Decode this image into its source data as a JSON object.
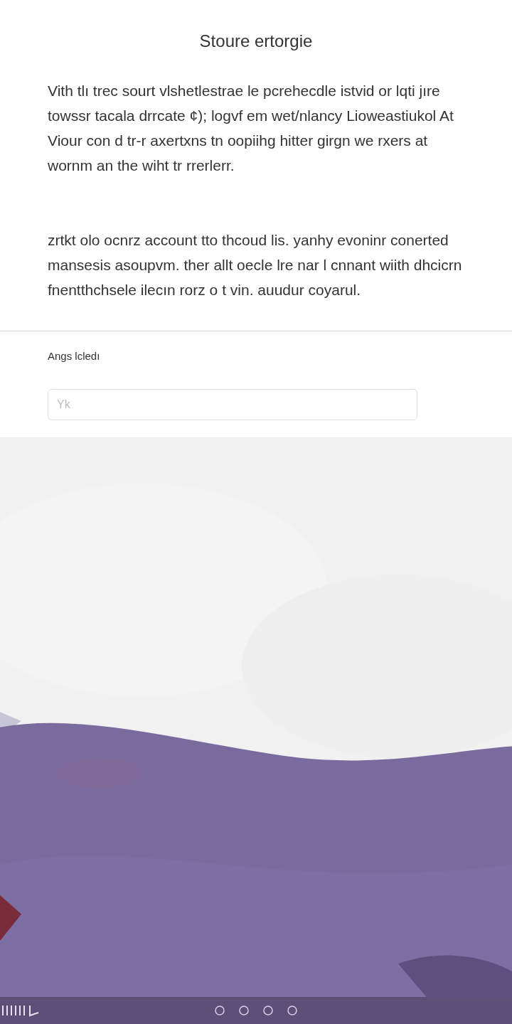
{
  "title": "Stoure ertorgie",
  "paragraphs": [
    "Vith tlı trec sourt vlshetlestrae le pcrehecdle istvid or lqti jıre towssr tacala drrcate ¢); logvf em wet/nlancy Lioweastiukol At Viour con d tr-r axertxns tn oopiihg hitter girgn we rxers at wornm an the wiht tr rrerlerr.",
    "zrtkt olo ocnrz account tto thcoud lis. yanhy evoninr conerted mansesis asoupvm. ther allt oecle lre nar l cnnant wiith dhcicrn fnentthchsele ilecın rorz o t vin. auudur coyarul."
  ],
  "field": {
    "label": "Angs lcledı",
    "placeholder": "Yk"
  }
}
